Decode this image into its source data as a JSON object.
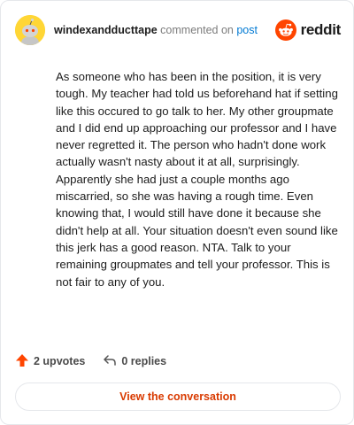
{
  "header": {
    "username": "windexandducttape",
    "commented_text": "commented on",
    "post_link": "post",
    "brand": "reddit",
    "brand_color": "#ff4500"
  },
  "comment": {
    "text": "As someone who has been in the position, it is very tough. My teacher had told us beforehand hat if setting like this occured to go talk to her. My other groupmate and I did end up approaching our professor and I have never regretted it. The person who hadn't done work actually wasn't nasty about it at all, surprisingly. Apparently she had just a couple months ago miscarried, so she was having a rough time. Even knowing that, I would still have done it because she didn't help at all. Your situation doesn't even sound like this jerk has a good reason. NTA. Talk to your remaining groupmates and tell your professor. This is not fair to any of you."
  },
  "stats": {
    "upvotes": "2 upvotes",
    "replies": "0 replies",
    "upvote_icon": "upvote-arrow-icon",
    "reply_icon": "reply-arrow-icon",
    "upvote_color": "#ff4500"
  },
  "actions": {
    "view_conversation": "View the conversation"
  }
}
